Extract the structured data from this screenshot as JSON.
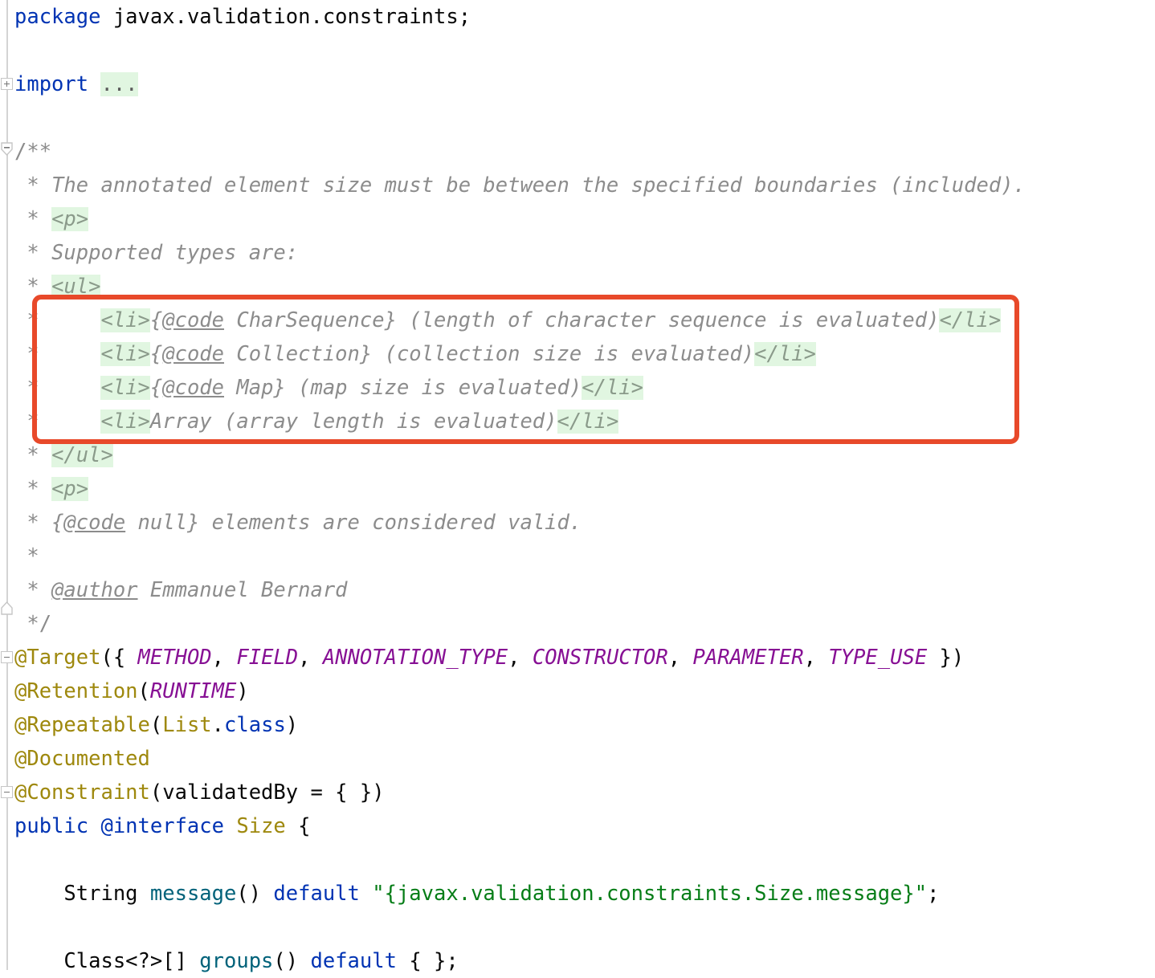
{
  "editor": {
    "language": "java",
    "file_declares": "javax.validation.constraints.Size",
    "colors": {
      "keyword": "#0033b3",
      "annotation": "#9e880d",
      "enum_constant": "#871094",
      "string": "#067d17",
      "method": "#00627a",
      "comment": "#8c8c8c",
      "doc_tag_highlight_bg": "#e1f6e1",
      "highlight_box": "#e8492a",
      "background": "#ffffff"
    }
  },
  "annotation_box": {
    "shape": "rounded-rectangle",
    "color": "#e8492a",
    "encloses": "the four <li> javadoc list item lines"
  },
  "code_lines": [
    {
      "n": 1,
      "segments": [
        {
          "t": "package ",
          "c": "kw"
        },
        {
          "t": "javax.validation.constraints;",
          "c": "plain"
        }
      ]
    },
    {
      "n": 2,
      "segments": []
    },
    {
      "n": 3,
      "segments": [
        {
          "t": "import ",
          "c": "kw"
        },
        {
          "t": "...",
          "c": "foldph"
        }
      ]
    },
    {
      "n": 4,
      "segments": []
    },
    {
      "n": 5,
      "segments": [
        {
          "t": "/**",
          "c": "cmtplain"
        }
      ]
    },
    {
      "n": 6,
      "segments": [
        {
          "t": " * ",
          "c": "cmtplain"
        },
        {
          "t": "The annotated element size must be between the specified boundaries (included).",
          "c": "cmt"
        }
      ]
    },
    {
      "n": 7,
      "segments": [
        {
          "t": " * ",
          "c": "cmtplain"
        },
        {
          "t": "<p>",
          "c": "tag"
        }
      ]
    },
    {
      "n": 8,
      "segments": [
        {
          "t": " * ",
          "c": "cmtplain"
        },
        {
          "t": "Supported types are:",
          "c": "cmt"
        }
      ]
    },
    {
      "n": 9,
      "segments": [
        {
          "t": " * ",
          "c": "cmtplain"
        },
        {
          "t": "<ul>",
          "c": "tag"
        }
      ]
    },
    {
      "n": 10,
      "segments": [
        {
          "t": " *     ",
          "c": "cmtplain"
        },
        {
          "t": "<li>",
          "c": "tag"
        },
        {
          "t": "{",
          "c": "cmt"
        },
        {
          "t": "@code",
          "c": "doctag"
        },
        {
          "t": " CharSequence} (length of character sequence is evaluated)",
          "c": "cmt"
        },
        {
          "t": "</li>",
          "c": "tag"
        }
      ]
    },
    {
      "n": 11,
      "segments": [
        {
          "t": " *     ",
          "c": "cmtplain"
        },
        {
          "t": "<li>",
          "c": "tag"
        },
        {
          "t": "{",
          "c": "cmt"
        },
        {
          "t": "@code",
          "c": "doctag"
        },
        {
          "t": " Collection} (collection size is evaluated)",
          "c": "cmt"
        },
        {
          "t": "</li>",
          "c": "tag"
        }
      ]
    },
    {
      "n": 12,
      "segments": [
        {
          "t": " *     ",
          "c": "cmtplain"
        },
        {
          "t": "<li>",
          "c": "tag"
        },
        {
          "t": "{",
          "c": "cmt"
        },
        {
          "t": "@code",
          "c": "doctag"
        },
        {
          "t": " Map} (map size is evaluated)",
          "c": "cmt"
        },
        {
          "t": "</li>",
          "c": "tag"
        }
      ]
    },
    {
      "n": 13,
      "segments": [
        {
          "t": " *     ",
          "c": "cmtplain"
        },
        {
          "t": "<li>",
          "c": "tag"
        },
        {
          "t": "Array (array length is evaluated)",
          "c": "cmt"
        },
        {
          "t": "</li>",
          "c": "tag"
        }
      ]
    },
    {
      "n": 14,
      "segments": [
        {
          "t": " * ",
          "c": "cmtplain"
        },
        {
          "t": "</ul>",
          "c": "tag"
        }
      ]
    },
    {
      "n": 15,
      "segments": [
        {
          "t": " * ",
          "c": "cmtplain"
        },
        {
          "t": "<p>",
          "c": "tag"
        }
      ]
    },
    {
      "n": 16,
      "segments": [
        {
          "t": " * ",
          "c": "cmtplain"
        },
        {
          "t": "{",
          "c": "cmt"
        },
        {
          "t": "@code",
          "c": "doctag"
        },
        {
          "t": " null} elements are considered valid.",
          "c": "cmt"
        }
      ]
    },
    {
      "n": 17,
      "segments": [
        {
          "t": " *",
          "c": "cmtplain"
        }
      ]
    },
    {
      "n": 18,
      "segments": [
        {
          "t": " * ",
          "c": "cmtplain"
        },
        {
          "t": "@author",
          "c": "doctag"
        },
        {
          "t": " Emmanuel Bernard",
          "c": "cmt"
        }
      ]
    },
    {
      "n": 19,
      "segments": [
        {
          "t": " */",
          "c": "cmtplain"
        }
      ]
    },
    {
      "n": 20,
      "segments": [
        {
          "t": "@Target",
          "c": "anno"
        },
        {
          "t": "({ ",
          "c": "plain"
        },
        {
          "t": "METHOD",
          "c": "enumc"
        },
        {
          "t": ", ",
          "c": "plain"
        },
        {
          "t": "FIELD",
          "c": "enumc"
        },
        {
          "t": ", ",
          "c": "plain"
        },
        {
          "t": "ANNOTATION_TYPE",
          "c": "enumc"
        },
        {
          "t": ", ",
          "c": "plain"
        },
        {
          "t": "CONSTRUCTOR",
          "c": "enumc"
        },
        {
          "t": ", ",
          "c": "plain"
        },
        {
          "t": "PARAMETER",
          "c": "enumc"
        },
        {
          "t": ", ",
          "c": "plain"
        },
        {
          "t": "TYPE_USE",
          "c": "enumc"
        },
        {
          "t": " })",
          "c": "plain"
        }
      ]
    },
    {
      "n": 21,
      "segments": [
        {
          "t": "@Retention",
          "c": "anno"
        },
        {
          "t": "(",
          "c": "plain"
        },
        {
          "t": "RUNTIME",
          "c": "enumc"
        },
        {
          "t": ")",
          "c": "plain"
        }
      ]
    },
    {
      "n": 22,
      "segments": [
        {
          "t": "@Repeatable",
          "c": "anno"
        },
        {
          "t": "(",
          "c": "plain"
        },
        {
          "t": "List",
          "c": "cls"
        },
        {
          "t": ".",
          "c": "plain"
        },
        {
          "t": "class",
          "c": "kw"
        },
        {
          "t": ")",
          "c": "plain"
        }
      ]
    },
    {
      "n": 23,
      "segments": [
        {
          "t": "@Documented",
          "c": "anno"
        }
      ]
    },
    {
      "n": 24,
      "segments": [
        {
          "t": "@Constraint",
          "c": "anno"
        },
        {
          "t": "(validatedBy = { })",
          "c": "plain"
        }
      ]
    },
    {
      "n": 25,
      "segments": [
        {
          "t": "public ",
          "c": "kw"
        },
        {
          "t": "@interface",
          "c": "kw"
        },
        {
          "t": " ",
          "c": "plain"
        },
        {
          "t": "Size",
          "c": "cls"
        },
        {
          "t": " {",
          "c": "plain"
        }
      ]
    },
    {
      "n": 26,
      "segments": []
    },
    {
      "n": 27,
      "segments": [
        {
          "t": "    String ",
          "c": "plain"
        },
        {
          "t": "message",
          "c": "method"
        },
        {
          "t": "() ",
          "c": "plain"
        },
        {
          "t": "default ",
          "c": "kw"
        },
        {
          "t": "\"{javax.validation.constraints.Size.message}\"",
          "c": "str"
        },
        {
          "t": ";",
          "c": "plain"
        }
      ]
    },
    {
      "n": 28,
      "segments": []
    },
    {
      "n": 29,
      "segments": [
        {
          "t": "    Class<?>[] ",
          "c": "plain"
        },
        {
          "t": "groups",
          "c": "method"
        },
        {
          "t": "() ",
          "c": "plain"
        },
        {
          "t": "default ",
          "c": "kw"
        },
        {
          "t": "{ };",
          "c": "plain"
        }
      ]
    }
  ],
  "gutter": {
    "fold_markers": [
      {
        "line": 3,
        "type": "expand",
        "label": "+"
      },
      {
        "line": 5,
        "type": "collapse",
        "label": "-"
      },
      {
        "line": 19,
        "type": "collapse",
        "label": "-"
      },
      {
        "line": 20,
        "type": "collapse",
        "label": "-"
      },
      {
        "line": 24,
        "type": "collapse",
        "label": "-"
      }
    ]
  }
}
